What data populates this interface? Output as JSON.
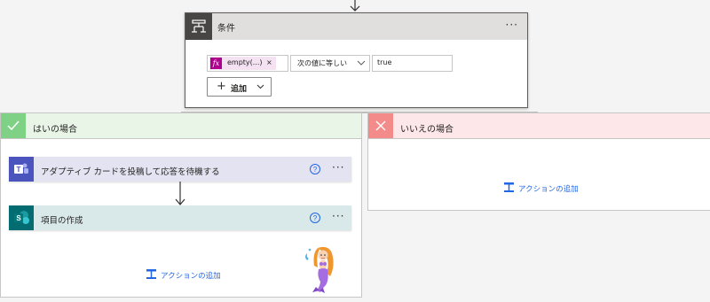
{
  "condition": {
    "title": "条件",
    "menu_glyph": "···",
    "token_label": "empty(...)",
    "token_remove": "×",
    "token_fx": "fx",
    "operator": "次の値に等しい",
    "value": "true",
    "add_label": "追加",
    "add_plus": "+"
  },
  "yes_branch": {
    "title": "はいの場合",
    "actions": [
      {
        "title": "アダプティブ カードを投稿して応答を待機する",
        "menu_glyph": "···",
        "icon": "teams-icon"
      },
      {
        "title": "項目の作成",
        "menu_glyph": "···",
        "icon": "sharepoint-icon"
      }
    ],
    "add_action_label": "アクションの追加"
  },
  "no_branch": {
    "title": "いいえの場合",
    "add_action_label": "アクションの追加"
  },
  "colors": {
    "yes_accent": "#7ed185",
    "no_accent": "#f48b8b",
    "link": "#2266e3",
    "fx_token": "#ad008c"
  }
}
